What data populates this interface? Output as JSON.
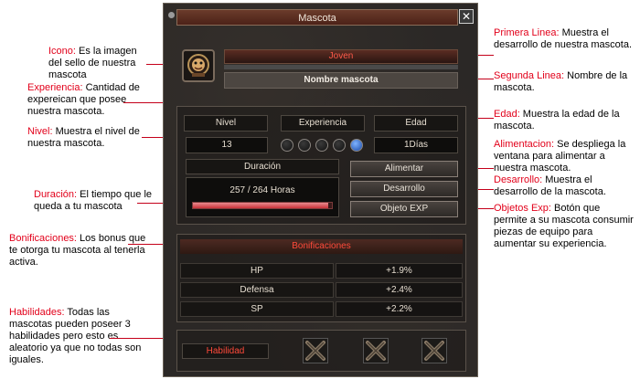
{
  "window": {
    "title": "Mascota",
    "close_label": "✕",
    "level_bar_text": "Joven",
    "name": "Nombre mascota",
    "labels": {
      "nivel": "Nivel",
      "experiencia": "Experiencia",
      "edad": "Edad"
    },
    "values": {
      "nivel": "13",
      "edad": "1Días"
    },
    "experience_orbs": {
      "filled": 1,
      "total": 5
    },
    "duracion": {
      "label": "Duración",
      "text": "257 / 264 Horas",
      "fraction": 0.973
    },
    "buttons": {
      "alimentar": "Alimentar",
      "desarrollo": "Desarrollo",
      "objeto_exp": "Objeto EXP"
    },
    "bonificaciones": {
      "title": "Bonificaciones",
      "rows": [
        {
          "stat": "HP",
          "value": "+1.9%"
        },
        {
          "stat": "Defensa",
          "value": "+2.4%"
        },
        {
          "stat": "SP",
          "value": "+2.2%"
        }
      ]
    },
    "habilidad_label": "Habilidad"
  },
  "annotations": {
    "icono": {
      "key": "Icono:",
      "text": " Es la imagen del sello de nuestra mascota"
    },
    "experiencia": {
      "key": "Experiencia:",
      "text": " Cantidad de expereican que posee nuestra mascota."
    },
    "nivel": {
      "key": "Nivel:",
      "text": " Muestra el nivel de nuestra mascota."
    },
    "duracion": {
      "key": "Duración:",
      "text": " El tiempo que le queda a tu mascota"
    },
    "bonificaciones": {
      "key": "Bonificaciones:",
      "text": " Los bonus que te otorga tu mascota al tenerla activa."
    },
    "habilidades": {
      "key": "Habilidades:",
      "text": " Todas las mascotas pueden poseer 3 habilidades pero esto es aleatorio ya que no todas son iguales."
    },
    "primera_linea": {
      "key": "Primera Linea:",
      "text": " Muestra el desarrollo de nuestra mascota."
    },
    "segunda_linea": {
      "key": "Segunda Linea:",
      "text": " Nombre de la mascota."
    },
    "edad": {
      "key": "Edad:",
      "text": " Muestra la edad de la mascota."
    },
    "alimentacion": {
      "key": "Alimentacion:",
      "text": " Se despliega la ventana para alimentar a nuestra mascota."
    },
    "desarrollo": {
      "key": "Desarrollo:",
      "text": " Muestra el desarrollo de la mascota."
    },
    "objetos_exp": {
      "key": "Objetos Exp:",
      "text": " Botón que permite a su mascota consumir piezas de equipo para aumentar su experiencia."
    }
  },
  "colors": {
    "accent_red": "#e2001a",
    "panel_bg": "#2b2826",
    "bar_red": "#c9333a",
    "orb_blue": "#2f6fe0"
  }
}
